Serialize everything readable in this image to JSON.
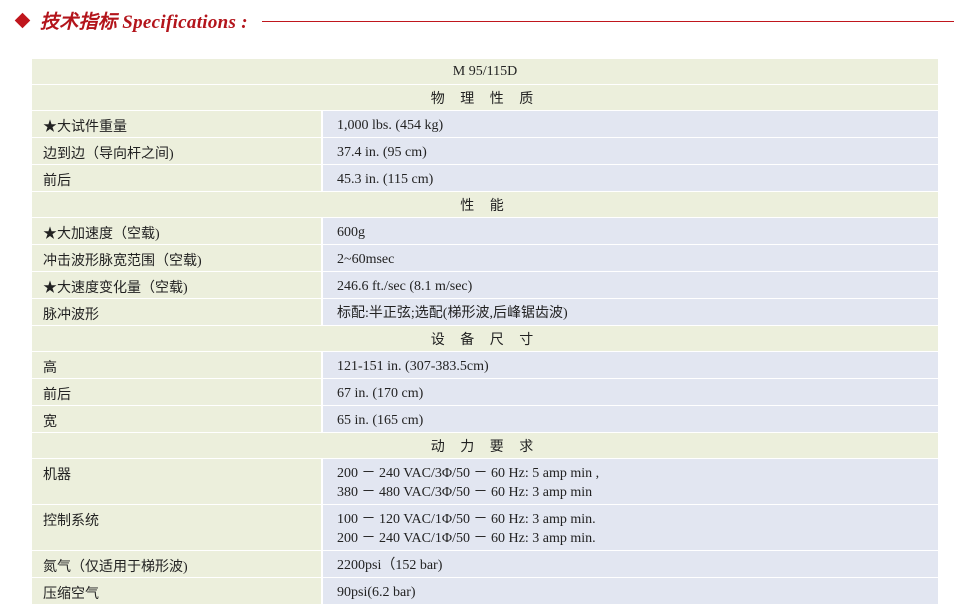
{
  "header": {
    "title": "技术指标 Specifications :"
  },
  "model": "M 95/115D",
  "sections": [
    {
      "heading": "物 理 性 质",
      "rows": [
        {
          "label": "★大试件重量",
          "values": [
            "1,000 lbs. (454 kg)"
          ]
        },
        {
          "label": "边到边（导向杆之间)",
          "values": [
            "37.4 in. (95 cm)"
          ]
        },
        {
          "label": "前后",
          "values": [
            "45.3 in. (115 cm)"
          ]
        }
      ]
    },
    {
      "heading": "性    能",
      "rows": [
        {
          "label": "★大加速度（空载)",
          "values": [
            "600g"
          ]
        },
        {
          "label": "冲击波形脉宽范围（空载)",
          "values": [
            "2~60msec"
          ]
        },
        {
          "label": "★大速度变化量（空载)",
          "values": [
            "246.6 ft./sec (8.1 m/sec)"
          ]
        },
        {
          "label": "脉冲波形",
          "values": [
            "标配:半正弦;选配(梯形波,后峰锯齿波)"
          ]
        }
      ]
    },
    {
      "heading": "设 备 尺 寸",
      "rows": [
        {
          "label": "高",
          "values": [
            "121-151 in. (307-383.5cm)"
          ]
        },
        {
          "label": "前后",
          "values": [
            "67 in. (170 cm)"
          ]
        },
        {
          "label": "宽",
          "values": [
            "65 in. (165 cm)"
          ]
        }
      ]
    },
    {
      "heading": "动 力 要 求",
      "rows": [
        {
          "label": "机器",
          "values": [
            "200 － 240 VAC/3Φ/50 － 60 Hz: 5 amp min ,",
            "380 － 480 VAC/3Φ/50 － 60 Hz: 3 amp min"
          ]
        },
        {
          "label": "控制系统",
          "values": [
            "100 － 120 VAC/1Φ/50 － 60 Hz: 3 amp min.",
            "200 － 240 VAC/1Φ/50 － 60 Hz: 3 amp min."
          ]
        },
        {
          "label": "氮气（仅适用于梯形波)",
          "values": [
            "2200psi（152 bar)"
          ]
        },
        {
          "label": "压缩空气",
          "values": [
            "90psi(6.2 bar)"
          ]
        }
      ]
    }
  ]
}
